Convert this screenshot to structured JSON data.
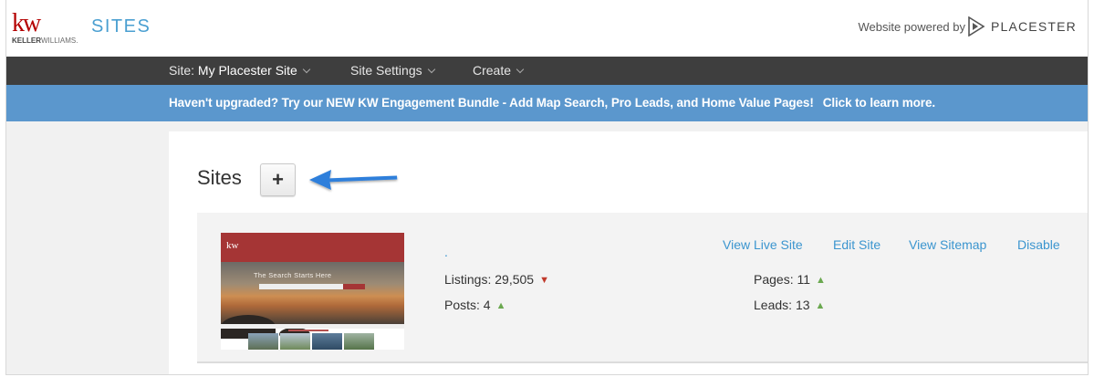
{
  "header": {
    "logo_text": "kw",
    "logo_brand_bold": "KELLER",
    "logo_brand_rest": "WILLIAMS.",
    "app_title": "SITES",
    "powered_by": "Website powered by",
    "provider_name": "PLACESTER"
  },
  "nav": {
    "site_prefix": "Site:",
    "site_name": "My Placester Site",
    "settings_label": "Site Settings",
    "create_label": "Create"
  },
  "banner": {
    "message": "Haven't upgraded? Try our NEW KW Engagement Bundle - Add Map Search, Pro Leads, and Home Value Pages!",
    "link_label": "Click to learn more."
  },
  "sites_section": {
    "heading": "Sites",
    "add_button_label": "+"
  },
  "site": {
    "name": ".",
    "thumbnail_headline": "The Search Starts Here",
    "thumbnail_logo": "kw",
    "stats": {
      "listings_label": "Listings:",
      "listings_value": "29,505",
      "listings_trend": "down",
      "posts_label": "Posts:",
      "posts_value": "4",
      "posts_trend": "up",
      "pages_label": "Pages:",
      "pages_value": "11",
      "pages_trend": "up",
      "leads_label": "Leads:",
      "leads_value": "13",
      "leads_trend": "up"
    },
    "actions": {
      "view_live": "View Live Site",
      "edit": "Edit Site",
      "view_sitemap": "View Sitemap",
      "disable": "Disable"
    }
  },
  "icons": {
    "add": "plus-icon",
    "trend_up": "triangle-up-icon",
    "trend_down": "triangle-down-icon",
    "dropdown": "chevron-down-icon",
    "callout": "arrow-left-icon"
  },
  "colors": {
    "brand_red": "#b40101",
    "accent_blue": "#4a9fd1",
    "banner_blue": "#5b97cd",
    "nav_dark": "#3e3e3e",
    "trend_up": "#6aa84f",
    "trend_down": "#c0392b",
    "callout_arrow": "#2f7fdb"
  }
}
